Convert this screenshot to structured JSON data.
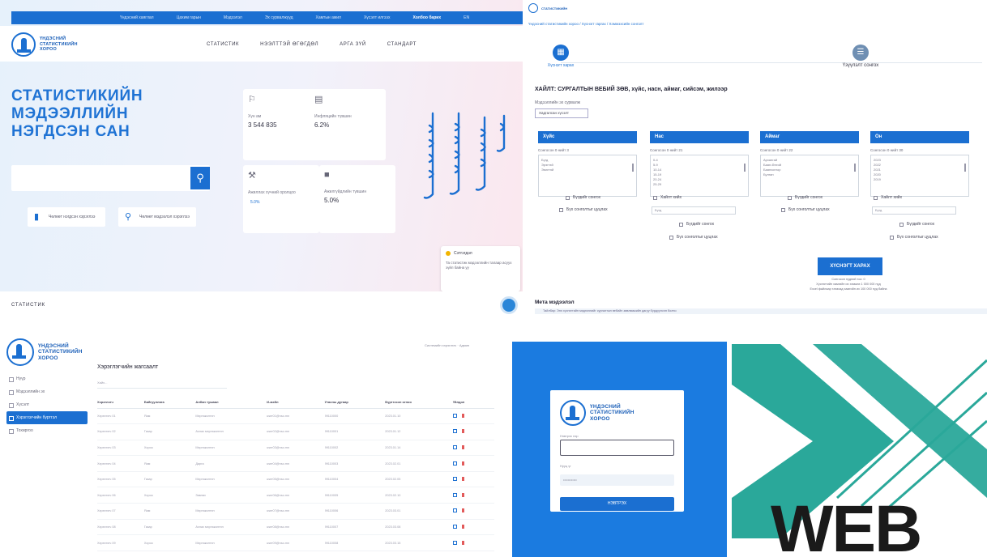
{
  "home": {
    "topbar_links": [
      "Үндэсний хаяглал",
      "Цахим гарын",
      "Мэдээлэл",
      "Эх сурвалжууд",
      "Хамтын ажил",
      "Хүсэлт илгээх",
      "Холбоо барих",
      "EN"
    ],
    "topbar_highlight_index": 6,
    "logo_lines": [
      "ҮНДЭСНИЙ",
      "СТАТИСТИКИЙН",
      "ХОРОО"
    ],
    "nav": [
      "СТАТИСТИК",
      "НЭЭЛТТЭЙ ӨГӨГДӨЛ",
      "АРГА ЗҮЙ",
      "СТАНДАРТ"
    ],
    "hero_title": "СТАТИСТИКИЙН МЭДЭЭЛЛИЙН НЭГДСЭН САН",
    "search_placeholder": "",
    "quick_links": [
      {
        "label": "Чөлөөт нэгдсэн хэрэглээ",
        "icon": "bar-chart-icon"
      },
      {
        "label": "Чөлөөт мэдээлэл хэрэглээ",
        "icon": "search-doc-icon"
      }
    ],
    "cards": [
      {
        "icon": "people-icon",
        "label": "Хүн ам",
        "value": "3 544 835"
      },
      {
        "icon": "chart-icon",
        "label": "Инфляцийн түвшин",
        "value": "6.2%"
      },
      {
        "icon": "worker-icon",
        "label": "Ажиллах хүчний оролцоо",
        "value": "",
        "badge": "5.0%"
      },
      {
        "icon": "money-icon",
        "label": "Ажилгүйдлийн түвшин",
        "value": "5.0%"
      }
    ],
    "chat": {
      "title": "Сэтгэгдэл",
      "text": "Та статистик мэдээллийн талаар асуух зүйл байна уу"
    },
    "bottom_label": "СТАТИСТИК"
  },
  "request": {
    "breadcrumb": "Үндэсний статистикийн хороо / Хүснэгт гаргах / Хэмжээсийн сонголт",
    "steps": [
      "Хүснэгт харах",
      "Үзүүлэлт сонгох"
    ],
    "title": "ХАЙЛТ: СУРГАЛТЫН ВЕБИЙ ЗӨВ, хүйс, насн, аймаг, сийсэм, жилээр",
    "subtitle": "Мэдээллийн эх сурвалж",
    "subset_button": "Хадгалсан хүсэлт",
    "dims": [
      {
        "title": "Хүйс",
        "count": "Сонгосон 0 нийт 3",
        "items": [
          "Бүгд",
          "Эрэгтэй",
          "Эмэгтэй"
        ]
      },
      {
        "title": "Нас",
        "count": "Сонгосон 0 нийт 21",
        "items": [
          "0-4",
          "5-9",
          "10-14",
          "15-19",
          "20-24",
          "25-29"
        ]
      },
      {
        "title": "Аймаг",
        "count": "Сонгосон 0 нийт 22",
        "items": [
          "Архангай",
          "Баян-Өлгий",
          "Баянхонгор",
          "Булган"
        ]
      },
      {
        "title": "Он",
        "count": "Сонгосон 0 нийт 30",
        "items": [
          "2023",
          "2022",
          "2021",
          "2020",
          "2019"
        ]
      }
    ],
    "check_all": "Бүгдийг сонгох",
    "check_none": "Бүх сонголтыг цуцлах",
    "check_filter": "Хайлт хийх",
    "select_placeholder": "Бүгд",
    "submit": "ХҮСНЭГТ ХАРАХ",
    "notes": [
      "Сонгосон нүдний тоо: 0",
      "Хүснэгтийн хамгийн их хэмжээ 1 000 000 нүд",
      "Excel файлаар татахад хамгийн их 100 000 нүд байна"
    ],
    "meta_title": "Мета мэдээлэл",
    "meta_row": "Тайлбар: Энэ хүснэгтийн мэдээллийг сургалтын вебийн зөвлөмжийн дагуу бүрдүүлсэн болно"
  },
  "admin": {
    "logo_lines": [
      "ҮНДЭСНИЙ",
      "СТАТИСТИКИЙН",
      "ХОРОО"
    ],
    "sidebar": [
      "Нүүр",
      "Мэдээллийн эх",
      "Хүсэлт",
      "Хэрэглэгчийн бүртгэл",
      "Тохиргоо"
    ],
    "active_index": 3,
    "page_title": "Хэрэглэгчийн жагсаалт",
    "filter_placeholder": "Хайх...",
    "toolbar": "Системийн хэрэглэгч · Админ",
    "columns": [
      "Хэрэглэгч",
      "Байгууллага",
      "Албан тушаал",
      "И-мэйл",
      "Утасны дугаар",
      "Бүртгэсэн огноо",
      "Үйлдэл"
    ],
    "rows": [
      [
        "Хэрэглэгч 01",
        "Яам",
        "Мэргэжилтэн",
        "user01@nso.mn",
        "99110000",
        "2023.01.10"
      ],
      [
        "Хэрэглэгч 02",
        "Газар",
        "Ахлах мэргэжилтэн",
        "user02@nso.mn",
        "99110001",
        "2023.01.12"
      ],
      [
        "Хэрэглэгч 03",
        "Хороо",
        "Мэргэжилтэн",
        "user03@nso.mn",
        "99110002",
        "2023.01.14"
      ],
      [
        "Хэрэглэгч 04",
        "Яам",
        "Дарга",
        "user04@nso.mn",
        "99110003",
        "2023.02.01"
      ],
      [
        "Хэрэглэгч 05",
        "Газар",
        "Мэргэжилтэн",
        "user05@nso.mn",
        "99110004",
        "2023.02.05"
      ],
      [
        "Хэрэглэгч 06",
        "Хороо",
        "Зөвлөх",
        "user06@nso.mn",
        "99110005",
        "2023.02.10"
      ],
      [
        "Хэрэглэгч 07",
        "Яам",
        "Мэргэжилтэн",
        "user07@nso.mn",
        "99110006",
        "2023.03.01"
      ],
      [
        "Хэрэглэгч 08",
        "Газар",
        "Ахлах мэргэжилтэн",
        "user08@nso.mn",
        "99110007",
        "2023.03.08"
      ],
      [
        "Хэрэглэгч 09",
        "Хороо",
        "Мэргэжилтэн",
        "user09@nso.mn",
        "99110008",
        "2023.03.15"
      ]
    ]
  },
  "login": {
    "logo_lines": [
      "ҮНДЭСНИЙ",
      "СТАТИСТИКИЙН",
      "ХОРОО"
    ],
    "user_label": "Нэвтрэх нэр",
    "password_label": "Нууц үг",
    "password_value": "••••••••••••",
    "button": "НЭВТРЭХ"
  },
  "brand": {
    "word": "WEB",
    "colors": {
      "teal": "#2aa89a",
      "dark": "#1a1a1a",
      "blue": "#1b6fd1"
    }
  }
}
